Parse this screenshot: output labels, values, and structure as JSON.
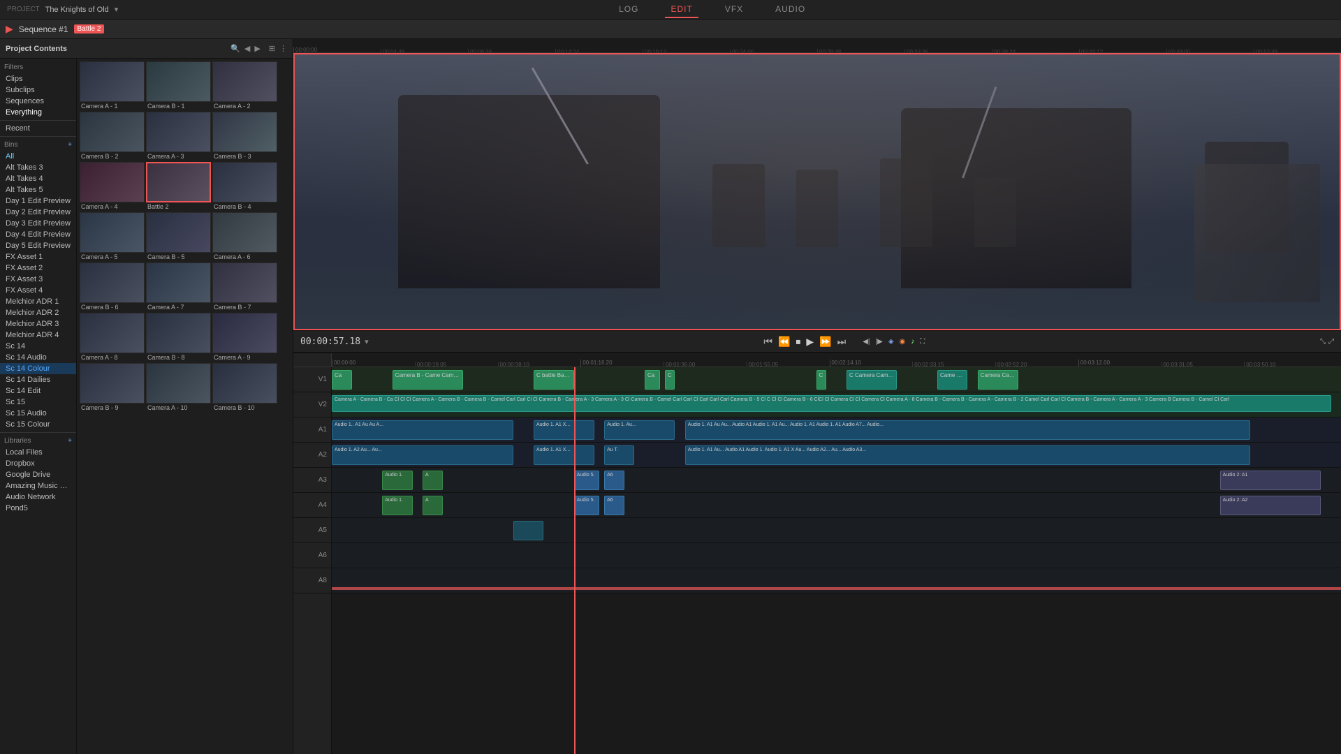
{
  "app": {
    "project_label": "PROJECT",
    "project_name": "The Knights of Old"
  },
  "nav_tabs": [
    {
      "id": "log",
      "label": "LOG",
      "active": false
    },
    {
      "id": "edit",
      "label": "EDIT",
      "active": true
    },
    {
      "id": "vfx",
      "label": "VFX",
      "active": false
    },
    {
      "id": "audio",
      "label": "AUDIO",
      "active": false
    }
  ],
  "toolbar": {
    "sequence_label": "Sequence #1",
    "sequence_badge": "Battle 2"
  },
  "left_panel": {
    "title": "Project Contents"
  },
  "filters": {
    "label": "Filters",
    "items": [
      "Clips",
      "Subclips",
      "Sequences",
      "Everything"
    ]
  },
  "recent_label": "Recent",
  "bins_label": "Bins",
  "sidebar_bins": [
    "All",
    "Alt Takes 3",
    "Alt Takes 4",
    "Alt Takes 5",
    "Day 1 Edit Preview",
    "Day 2 Edit Preview",
    "Day 3 Edit Preview",
    "Day 4 Edit Preview",
    "Day 5 Edit Preview",
    "FX Asset 1",
    "FX Asset 2",
    "FX Asset 3",
    "FX Asset 4",
    "Melchior ADR 1",
    "Melchior ADR 2",
    "Melchior ADR 3",
    "Melchior ADR 4",
    "Sc 14",
    "Sc 14 Audio",
    "Sc 14 Colour",
    "Sc 14 Dailies",
    "Sc 14 Edit",
    "Sc 15",
    "Sc 15 Audio",
    "Sc 15 Colour"
  ],
  "libraries_label": "Libraries",
  "libraries": [
    "Local Files",
    "Dropbox",
    "Google Drive",
    "Amazing Music Tracks",
    "Audio Network",
    "Pond5"
  ],
  "media_items": [
    {
      "label": "Camera A - 1",
      "selected": false
    },
    {
      "label": "Camera B - 1",
      "selected": false
    },
    {
      "label": "Camera A - 2",
      "selected": false
    },
    {
      "label": "Camera B - 2",
      "selected": false
    },
    {
      "label": "Camera A - 3",
      "selected": false
    },
    {
      "label": "Camera B - 3",
      "selected": false
    },
    {
      "label": "Camera A - 4",
      "selected": false
    },
    {
      "label": "Camera B - 4",
      "selected": false
    },
    {
      "label": "Battle 2",
      "selected": true
    },
    {
      "label": "Camera A - 5",
      "selected": false
    },
    {
      "label": "Camera B - 5",
      "selected": false
    },
    {
      "label": "Camera A - 6",
      "selected": false
    },
    {
      "label": "Camera B - 6",
      "selected": false
    },
    {
      "label": "Camera A - 7",
      "selected": false
    },
    {
      "label": "Camera B - 7",
      "selected": false
    },
    {
      "label": "Camera A - 8",
      "selected": false
    },
    {
      "label": "Camera B - 8",
      "selected": false
    },
    {
      "label": "Camera A - 9",
      "selected": false
    },
    {
      "label": "Camera B - 9",
      "selected": false
    },
    {
      "label": "Camera A - 10",
      "selected": false
    },
    {
      "label": "Camera B - 10",
      "selected": false
    }
  ],
  "timecode": {
    "current": "00:00:57.18",
    "total": "00:00:57.18"
  },
  "tracks": [
    {
      "id": "V1",
      "label": "V1",
      "type": "video"
    },
    {
      "id": "V2",
      "label": "V2",
      "type": "video"
    },
    {
      "id": "A1",
      "label": "A1",
      "type": "audio"
    },
    {
      "id": "A2",
      "label": "A2",
      "type": "audio"
    },
    {
      "id": "A3",
      "label": "A3",
      "type": "audio"
    },
    {
      "id": "A4",
      "label": "A4",
      "type": "audio"
    },
    {
      "id": "A5",
      "label": "A5",
      "type": "audio"
    },
    {
      "id": "A6",
      "label": "A6",
      "type": "audio"
    },
    {
      "id": "A8",
      "label": "A8",
      "type": "audio"
    }
  ],
  "ruler_marks": [
    "00:00:00",
    "00:00:19.05",
    "00:00:38.10",
    "00:01:16.20",
    "00:01:36.00",
    "00:01:55.05",
    "00:02:14.10",
    "00:02:33.15",
    "00:02:52.20",
    "00:03:12.00",
    "00:03:31.05",
    "00:03:50.10"
  ]
}
